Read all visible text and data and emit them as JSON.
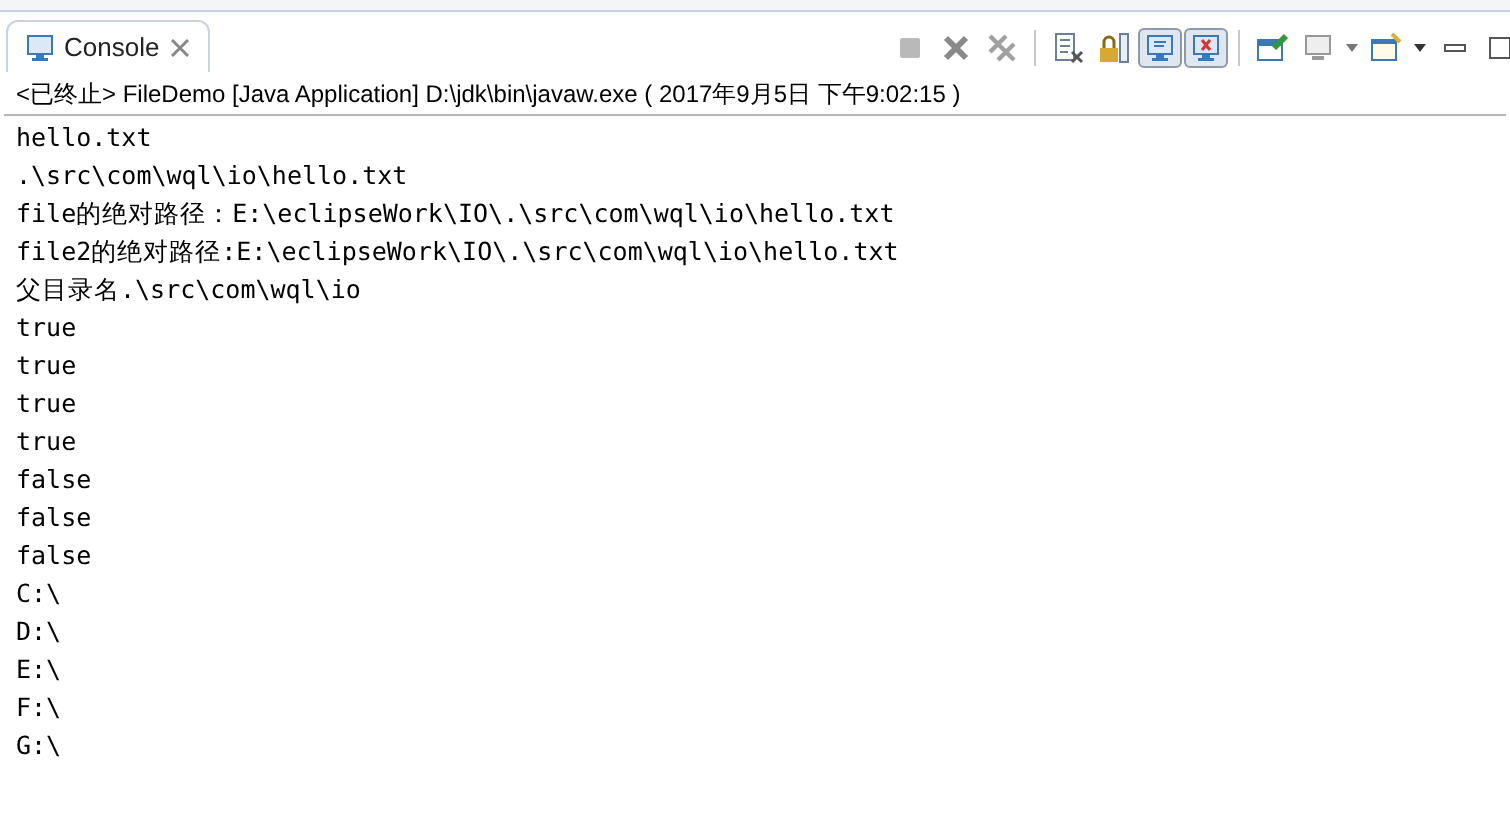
{
  "tab": {
    "label": "Console",
    "selected": true
  },
  "toggles": [
    {
      "selected": false
    },
    {
      "selected": true
    },
    {
      "selected": true
    }
  ],
  "status": "<已终止> FileDemo [Java Application] D:\\jdk\\bin\\javaw.exe ( 2017年9月5日 下午9:02:15 )",
  "output": [
    "hello.txt",
    ".\\src\\com\\wql\\io\\hello.txt",
    "file的绝对路径：E:\\eclipseWork\\IO\\.\\src\\com\\wql\\io\\hello.txt",
    "file2的绝对路径:E:\\eclipseWork\\IO\\.\\src\\com\\wql\\io\\hello.txt",
    "父目录名.\\src\\com\\wql\\io",
    "true",
    "true",
    "true",
    "true",
    "false",
    "false",
    "false",
    "C:\\",
    "D:\\",
    "E:\\",
    "F:\\",
    "G:\\"
  ]
}
